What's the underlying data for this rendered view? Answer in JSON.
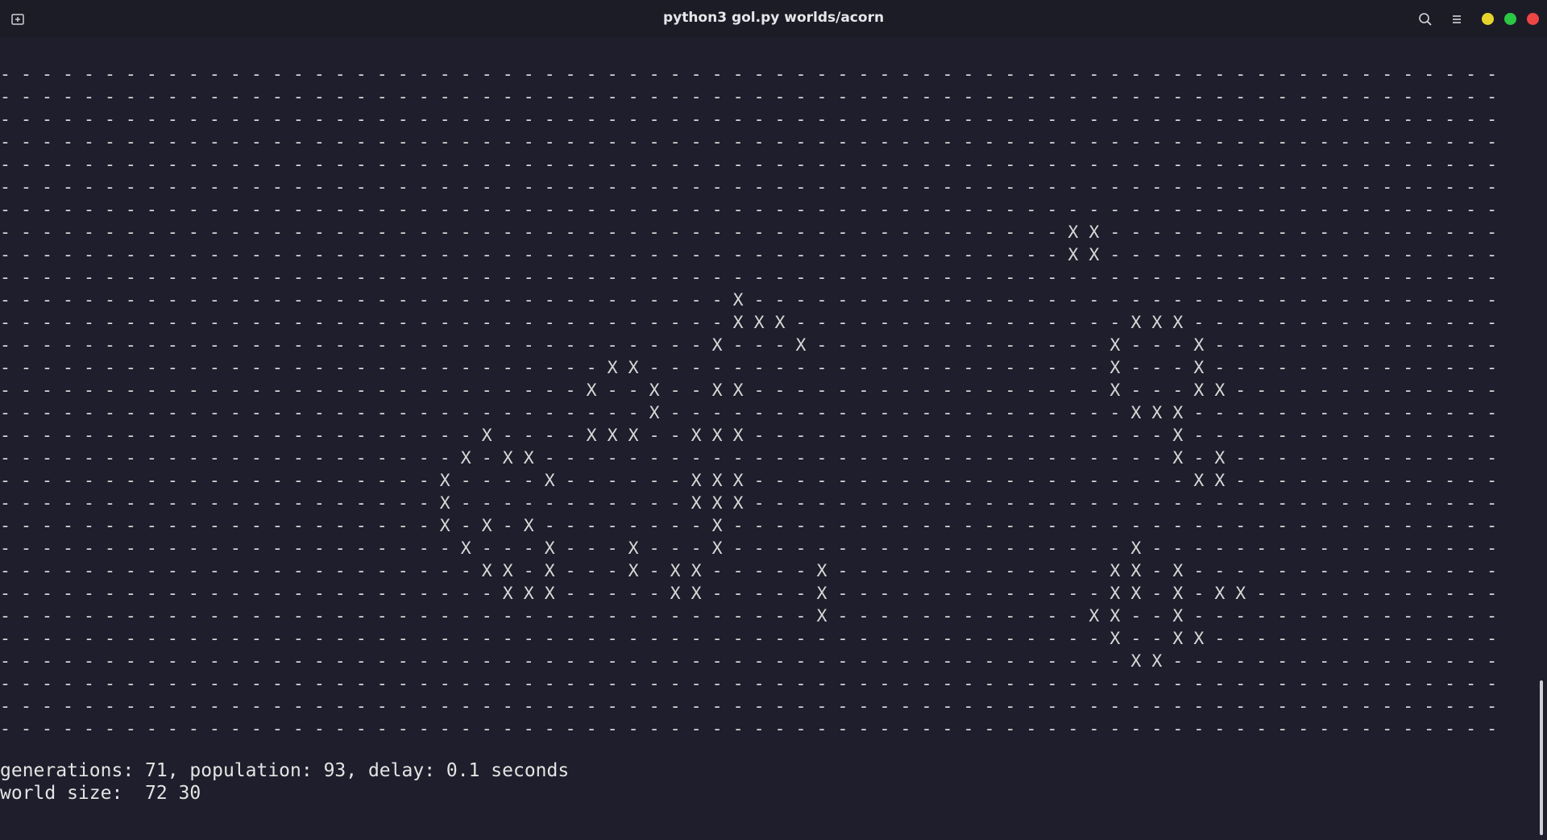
{
  "window": {
    "title": "python3 gol.py worlds/acorn"
  },
  "colors": {
    "background": "#1e1e2c",
    "titlebar": "#1c1c27",
    "text": "#d8d8d8",
    "minimize": "#e6d42c",
    "maximize": "#2bc844",
    "close": "#f04545"
  },
  "icons": {
    "tab": "new-tab-icon",
    "search": "search-icon",
    "menu": "hamburger-menu-icon",
    "minimize": "minimize-dot-icon",
    "maximize": "maximize-dot-icon",
    "close": "close-dot-icon"
  },
  "grid": {
    "rows": [
      "- - - - - - - - - - - - - - - - - - - - - - - - - - - - - - - - - - - - - - - - - - - - - - - - - - - - - - - - - - - - - - - - - - - - - - - -",
      "- - - - - - - - - - - - - - - - - - - - - - - - - - - - - - - - - - - - - - - - - - - - - - - - - - - - - - - - - - - - - - - - - - - - - - - -",
      "- - - - - - - - - - - - - - - - - - - - - - - - - - - - - - - - - - - - - - - - - - - - - - - - - - - - - - - - - - - - - - - - - - - - - - - -",
      "- - - - - - - - - - - - - - - - - - - - - - - - - - - - - - - - - - - - - - - - - - - - - - - - - - - - - - - - - - - - - - - - - - - - - - - -",
      "- - - - - - - - - - - - - - - - - - - - - - - - - - - - - - - - - - - - - - - - - - - - - - - - - - - - - - - - - - - - - - - - - - - - - - - -",
      "- - - - - - - - - - - - - - - - - - - - - - - - - - - - - - - - - - - - - - - - - - - - - - - - - - - - - - - - - - - - - - - - - - - - - - - -",
      "- - - - - - - - - - - - - - - - - - - - - - - - - - - - - - - - - - - - - - - - - - - - - - - - - - - - - - - - - - - - - - - - - - - - - - - -",
      "- - - - - - - - - - - - - - - - - - - - - - - - - - - - - - - - - - - - - - - - - - - - - - - - - - - X X - - - - - - - - - - - - - - - - - - -",
      "- - - - - - - - - - - - - - - - - - - - - - - - - - - - - - - - - - - - - - - - - - - - - - - - - - - X X - - - - - - - - - - - - - - - - - - -",
      "- - - - - - - - - - - - - - - - - - - - - - - - - - - - - - - - - - - - - - - - - - - - - - - - - - - - - - - - - - - - - - - - - - - - - - - -",
      "- - - - - - - - - - - - - - - - - - - - - - - - - - - - - - - - - - - X - - - - - - - - - - - - - - - - - - - - - - - - - - - - - - - - - - - -",
      "- - - - - - - - - - - - - - - - - - - - - - - - - - - - - - - - - - - X X X - - - - - - - - - - - - - - - - X X X - - - - - - - - - - - - - - -",
      "- - - - - - - - - - - - - - - - - - - - - - - - - - - - - - - - - - X - - - X - - - - - - - - - - - - - - X - - - X - - - - - - - - - - - - - -",
      "- - - - - - - - - - - - - - - - - - - - - - - - - - - - - X X - - - - - - - - - - - - - - - - - - - - - - X - - - X - - - - - - - - - - - - - -",
      "- - - - - - - - - - - - - - - - - - - - - - - - - - - - X - - X - - X X - - - - - - - - - - - - - - - - - X - - - X X - - - - - - - - - - - - -",
      "- - - - - - - - - - - - - - - - - - - - - - - - - - - - - - - X - - - - - - - - - - - - - - - - - - - - - - X X X - - - - - - - - - - - - - - -",
      "- - - - - - - - - - - - - - - - - - - - - - - X - - - - X X X - - X X X - - - - - - - - - - - - - - - - - - - - X - - - - - - - - - - - - - - -",
      "- - - - - - - - - - - - - - - - - - - - - - X - X X - - - - - - - - - - - - - - - - - - - - - - - - - - - - - - X - X - - - - - - - - - - - - -",
      "- - - - - - - - - - - - - - - - - - - - - X - - - - X - - - - - - X X X - - - - - - - - - - - - - - - - - - - - - X X - - - - - - - - - - - - -",
      "- - - - - - - - - - - - - - - - - - - - - X - - - - - - - - - - - X X X - - - - - - - - - - - - - - - - - - - - - - - - - - - - - - - - - - - -",
      "- - - - - - - - - - - - - - - - - - - - - X - X - X - - - - - - - - X - - - - - - - - - - - - - - - - - - - - - - - - - - - - - - - - - - - - -",
      "- - - - - - - - - - - - - - - - - - - - - - X - - - X - - - X - - - X - - - - - - - - - - - - - - - - - - - X - - - - - - - - - - - - - - - - -",
      "- - - - - - - - - - - - - - - - - - - - - - - X X - X - - - X - X X - - - - - X - - - - - - - - - - - - - X X - X - - - - - - - - - - - - - - -",
      "- - - - - - - - - - - - - - - - - - - - - - - - X X X - - - - - X X - - - - - X - - - - - - - - - - - - - X X - X - X X - - - - - - - - - - - -",
      "- - - - - - - - - - - - - - - - - - - - - - - - - - - - - - - - - - - - - - - X - - - - - - - - - - - - X X - - X - - - - - - - - - - - - - - -",
      "- - - - - - - - - - - - - - - - - - - - - - - - - - - - - - - - - - - - - - - - - - - - - - - - - - - - - X - - X X - - - - - - - - - - - - - -",
      "- - - - - - - - - - - - - - - - - - - - - - - - - - - - - - - - - - - - - - - - - - - - - - - - - - - - - - X X - - - - - - - - - - - - - - - -",
      "- - - - - - - - - - - - - - - - - - - - - - - - - - - - - - - - - - - - - - - - - - - - - - - - - - - - - - - - - - - - - - - - - - - - - - - -",
      "- - - - - - - - - - - - - - - - - - - - - - - - - - - - - - - - - - - - - - - - - - - - - - - - - - - - - - - - - - - - - - - - - - - - - - - -",
      "- - - - - - - - - - - - - - - - - - - - - - - - - - - - - - - - - - - - - - - - - - - - - - - - - - - - - - - - - - - - - - - - - - - - - - - -"
    ]
  },
  "status": {
    "line1": "generations: 71, population: 93, delay: 0.1 seconds",
    "line2": "world size:  72 30"
  }
}
